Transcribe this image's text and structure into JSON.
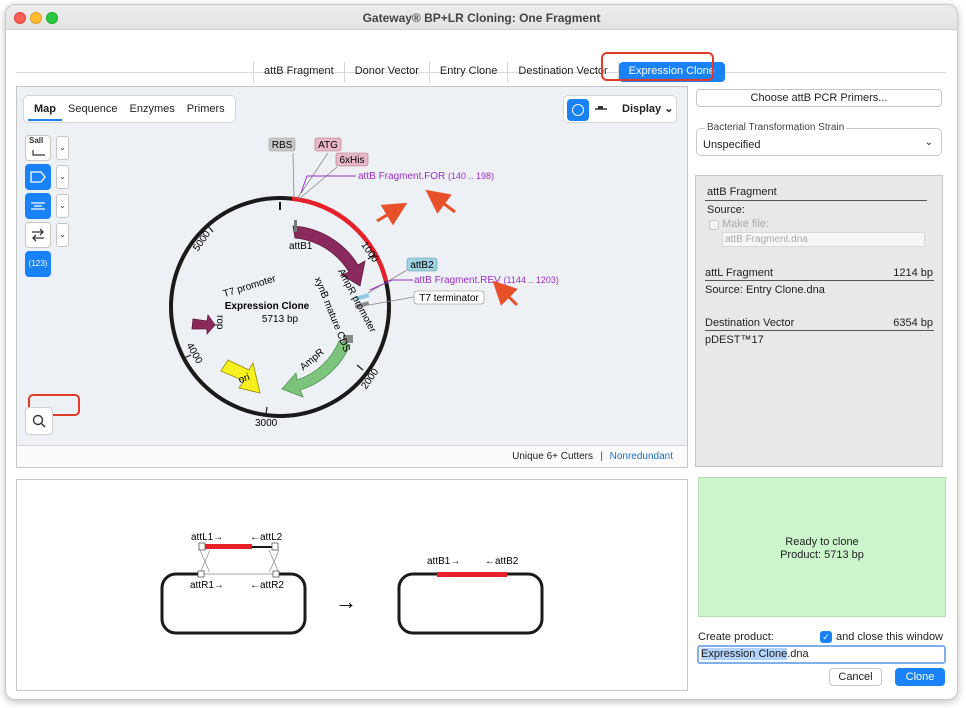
{
  "window": {
    "title": "Gateway® BP+LR Cloning: One Fragment"
  },
  "tabs": [
    {
      "label": "attB Fragment"
    },
    {
      "label": "Donor Vector"
    },
    {
      "label": "Entry Clone"
    },
    {
      "label": "Destination Vector"
    },
    {
      "label": "Expression Clone",
      "active": true
    }
  ],
  "map_tabs": [
    "Map",
    "Sequence",
    "Enzymes",
    "Primers"
  ],
  "view": {
    "display_label": "Display"
  },
  "tools": {
    "enzyme_label": "SalI",
    "count_label": "(123)"
  },
  "map": {
    "name": "Expression Clone",
    "size": "5713 bp",
    "ticks": [
      "1000",
      "2000",
      "3000",
      "4000",
      "5000"
    ],
    "features": {
      "rbs": "RBS",
      "atg": "ATG",
      "his": "6xHis",
      "attb1": "attB1",
      "attb2": "attB2",
      "t7_promoter": "T7 promoter",
      "t7_terminator": "T7 terminator",
      "ampr_promoter": "AmpR promoter",
      "cds": "xynB mature CDS",
      "ampr": "AmpR",
      "ori": "ori",
      "rop": "rop"
    },
    "primer_for": {
      "name": "attB Fragment.FOR",
      "range": "(140 .. 198)"
    },
    "primer_rev": {
      "name": "attB Fragment.REV",
      "range": "(1144 .. 1203)"
    },
    "colors": {
      "fragment": "#e8202a",
      "cds": "#8b2a5c",
      "ampr": "#7cc47c",
      "ori": "#f7f01e",
      "primer": "#9b30c8"
    }
  },
  "map_footer": {
    "cutters": "Unique 6+ Cutters",
    "separator": "|",
    "nonredundant": "Nonredundant"
  },
  "right": {
    "choose_button": "Choose attB PCR Primers...",
    "strain_label": "Bacterial Transformation Strain",
    "strain_value": "Unspecified"
  },
  "info": {
    "attb_title": "attB Fragment",
    "source_label": "Source:",
    "make_file_label": "Make file:",
    "make_file_value": "attB Fragment.dna",
    "attl_title": "attL Fragment",
    "attl_size": "1214 bp",
    "attl_source": "Source:  Entry Clone.dna",
    "dest_title": "Destination Vector",
    "dest_size": "6354 bp",
    "dest_name": "pDEST™17"
  },
  "diagram": {
    "attl1": "attL1→",
    "attl2": "←attL2",
    "attr1": "attR1→",
    "attr2": "←attR2",
    "attb1": "attB1→",
    "attb2": "←attB2",
    "arrow": "→"
  },
  "status": {
    "line1": "Ready to clone",
    "line2": "Product:  5713 bp"
  },
  "create": {
    "label": "Create product:",
    "close_label": "and close this window",
    "file_base": "Expression Clone",
    "file_ext": ".dna"
  },
  "buttons": {
    "cancel": "Cancel",
    "clone": "Clone"
  }
}
